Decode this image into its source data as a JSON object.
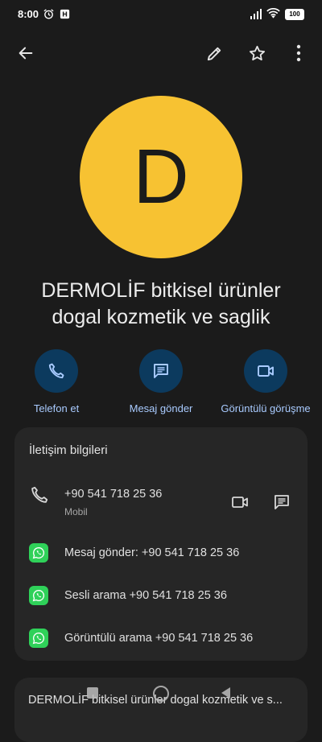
{
  "status_bar": {
    "time": "8:00",
    "battery": "100"
  },
  "contact": {
    "initial": "D",
    "name_line1": "DERMOLİF bitkisel ürünler",
    "name_line2": "dogal kozmetik ve saglik"
  },
  "actions": [
    {
      "label": "Telefon et",
      "icon": "phone-icon"
    },
    {
      "label": "Mesaj gönder",
      "icon": "message-icon"
    },
    {
      "label": "Görüntülü görüşme",
      "icon": "video-icon"
    }
  ],
  "contact_info": {
    "title": "İletişim bilgileri",
    "phone": {
      "number": "+90 541 718 25 36",
      "type": "Mobil"
    },
    "whatsapp": [
      {
        "label": "Mesaj gönder: +90 541 718 25 36"
      },
      {
        "label": "Sesli arama +90 541 718 25 36"
      },
      {
        "label": "Görüntülü arama +90 541 718 25 36"
      }
    ]
  },
  "next_card": {
    "title": "DERMOLİF bitkisel ürünler dogal kozmetik ve s..."
  },
  "colors": {
    "background": "#1b1b1b",
    "avatar": "#f7c232",
    "action_circle": "#0c3a5e",
    "action_label": "#a9cbff",
    "card": "#262626",
    "whatsapp": "#2fd159"
  }
}
